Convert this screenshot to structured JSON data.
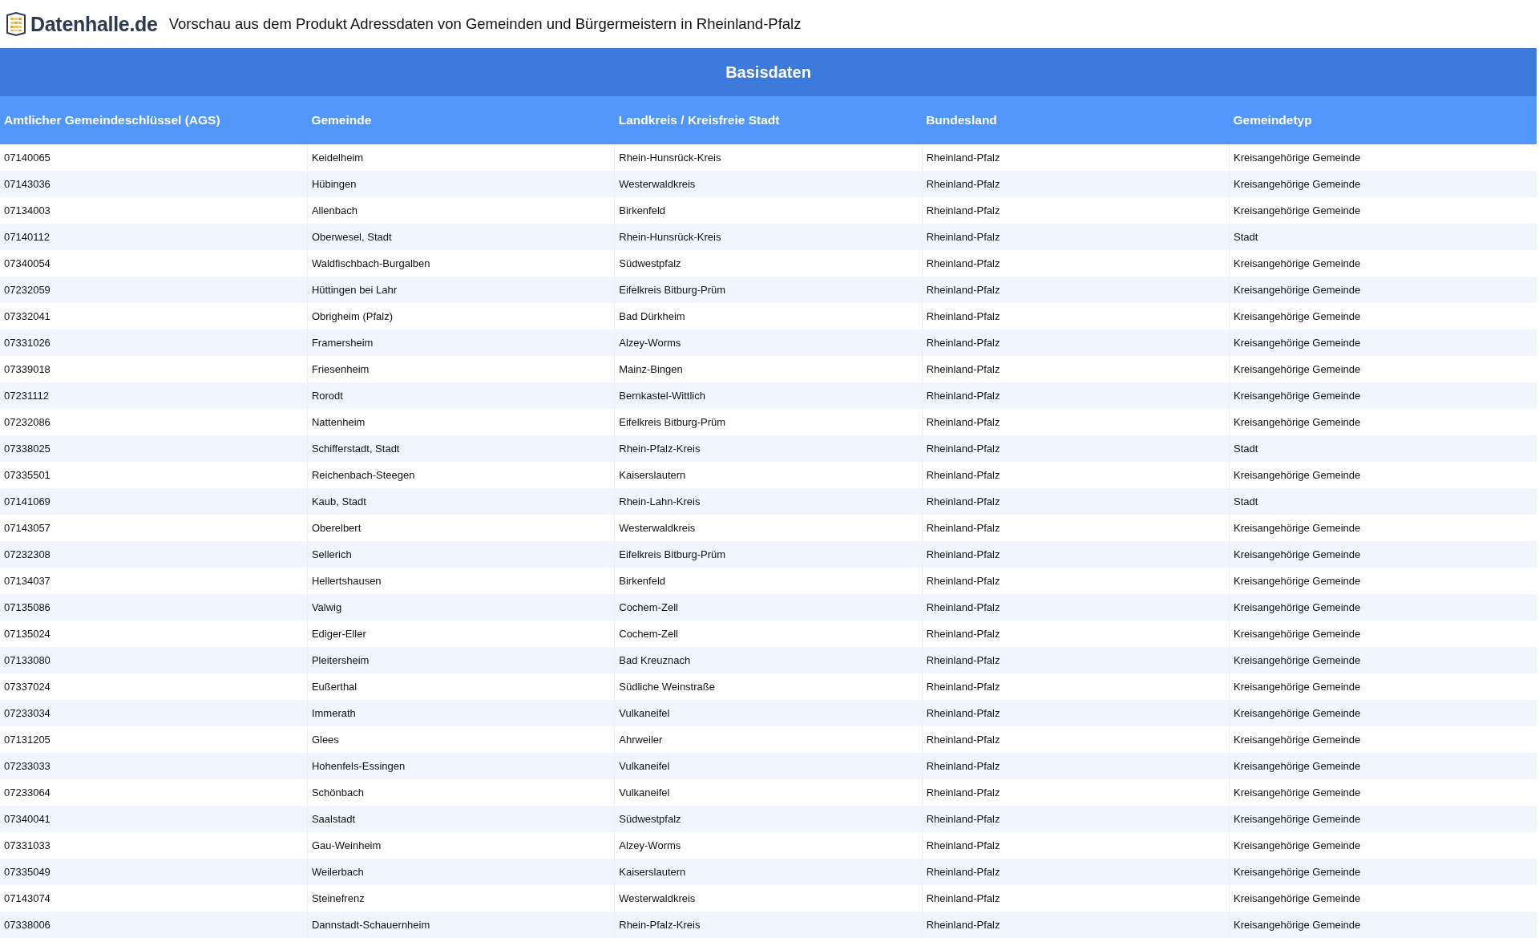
{
  "header": {
    "logo_text": "Datenhalle.de",
    "title": "Vorschau aus dem Produkt Adressdaten von Gemeinden und Bürgermeistern in Rheinland-Pfalz"
  },
  "table": {
    "group_heading": "Basisdaten",
    "columns": [
      "Amtlicher Gemeindeschlüssel (AGS)",
      "Gemeinde",
      "Landkreis / Kreisfreie Stadt",
      "Bundesland",
      "Gemeindetyp"
    ],
    "rows": [
      [
        "07140065",
        "Keidelheim",
        "Rhein-Hunsrück-Kreis",
        "Rheinland-Pfalz",
        "Kreisangehörige Gemeinde"
      ],
      [
        "07143036",
        "Hübingen",
        "Westerwaldkreis",
        "Rheinland-Pfalz",
        "Kreisangehörige Gemeinde"
      ],
      [
        "07134003",
        "Allenbach",
        "Birkenfeld",
        "Rheinland-Pfalz",
        "Kreisangehörige Gemeinde"
      ],
      [
        "07140112",
        "Oberwesel, Stadt",
        "Rhein-Hunsrück-Kreis",
        "Rheinland-Pfalz",
        "Stadt"
      ],
      [
        "07340054",
        "Waldfischbach-Burgalben",
        "Südwestpfalz",
        "Rheinland-Pfalz",
        "Kreisangehörige Gemeinde"
      ],
      [
        "07232059",
        "Hüttingen bei Lahr",
        "Eifelkreis Bitburg-Prüm",
        "Rheinland-Pfalz",
        "Kreisangehörige Gemeinde"
      ],
      [
        "07332041",
        "Obrigheim (Pfalz)",
        "Bad Dürkheim",
        "Rheinland-Pfalz",
        "Kreisangehörige Gemeinde"
      ],
      [
        "07331026",
        "Framersheim",
        "Alzey-Worms",
        "Rheinland-Pfalz",
        "Kreisangehörige Gemeinde"
      ],
      [
        "07339018",
        "Friesenheim",
        "Mainz-Bingen",
        "Rheinland-Pfalz",
        "Kreisangehörige Gemeinde"
      ],
      [
        "07231112",
        "Rorodt",
        "Bernkastel-Wittlich",
        "Rheinland-Pfalz",
        "Kreisangehörige Gemeinde"
      ],
      [
        "07232086",
        "Nattenheim",
        "Eifelkreis Bitburg-Prüm",
        "Rheinland-Pfalz",
        "Kreisangehörige Gemeinde"
      ],
      [
        "07338025",
        "Schifferstadt, Stadt",
        "Rhein-Pfalz-Kreis",
        "Rheinland-Pfalz",
        "Stadt"
      ],
      [
        "07335501",
        "Reichenbach-Steegen",
        "Kaiserslautern",
        "Rheinland-Pfalz",
        "Kreisangehörige Gemeinde"
      ],
      [
        "07141069",
        "Kaub, Stadt",
        "Rhein-Lahn-Kreis",
        "Rheinland-Pfalz",
        "Stadt"
      ],
      [
        "07143057",
        "Oberelbert",
        "Westerwaldkreis",
        "Rheinland-Pfalz",
        "Kreisangehörige Gemeinde"
      ],
      [
        "07232308",
        "Sellerich",
        "Eifelkreis Bitburg-Prüm",
        "Rheinland-Pfalz",
        "Kreisangehörige Gemeinde"
      ],
      [
        "07134037",
        "Hellertshausen",
        "Birkenfeld",
        "Rheinland-Pfalz",
        "Kreisangehörige Gemeinde"
      ],
      [
        "07135086",
        "Valwig",
        "Cochem-Zell",
        "Rheinland-Pfalz",
        "Kreisangehörige Gemeinde"
      ],
      [
        "07135024",
        "Ediger-Eller",
        "Cochem-Zell",
        "Rheinland-Pfalz",
        "Kreisangehörige Gemeinde"
      ],
      [
        "07133080",
        "Pleitersheim",
        "Bad Kreuznach",
        "Rheinland-Pfalz",
        "Kreisangehörige Gemeinde"
      ],
      [
        "07337024",
        "Eußerthal",
        "Südliche Weinstraße",
        "Rheinland-Pfalz",
        "Kreisangehörige Gemeinde"
      ],
      [
        "07233034",
        "Immerath",
        "Vulkaneifel",
        "Rheinland-Pfalz",
        "Kreisangehörige Gemeinde"
      ],
      [
        "07131205",
        "Glees",
        "Ahrweiler",
        "Rheinland-Pfalz",
        "Kreisangehörige Gemeinde"
      ],
      [
        "07233033",
        "Hohenfels-Essingen",
        "Vulkaneifel",
        "Rheinland-Pfalz",
        "Kreisangehörige Gemeinde"
      ],
      [
        "07233064",
        "Schönbach",
        "Vulkaneifel",
        "Rheinland-Pfalz",
        "Kreisangehörige Gemeinde"
      ],
      [
        "07340041",
        "Saalstadt",
        "Südwestpfalz",
        "Rheinland-Pfalz",
        "Kreisangehörige Gemeinde"
      ],
      [
        "07331033",
        "Gau-Weinheim",
        "Alzey-Worms",
        "Rheinland-Pfalz",
        "Kreisangehörige Gemeinde"
      ],
      [
        "07335049",
        "Weilerbach",
        "Kaiserslautern",
        "Rheinland-Pfalz",
        "Kreisangehörige Gemeinde"
      ],
      [
        "07143074",
        "Steinefrenz",
        "Westerwaldkreis",
        "Rheinland-Pfalz",
        "Kreisangehörige Gemeinde"
      ],
      [
        "07338006",
        "Dannstadt-Schauernheim",
        "Rhein-Pfalz-Kreis",
        "Rheinland-Pfalz",
        "Kreisangehörige Gemeinde"
      ]
    ]
  }
}
